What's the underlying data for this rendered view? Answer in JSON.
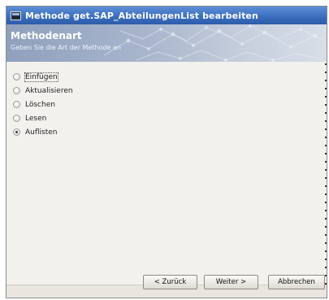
{
  "window": {
    "title": "Methode get.SAP_AbteilungenList bearbeiten"
  },
  "banner": {
    "title": "Methodenart",
    "subtitle": "Geben Sie die Art der Methode an"
  },
  "method_types": {
    "options": [
      {
        "label": "Einfügen",
        "selected": false,
        "focused": true
      },
      {
        "label": "Aktualisieren",
        "selected": false,
        "focused": false
      },
      {
        "label": "Löschen",
        "selected": false,
        "focused": false
      },
      {
        "label": "Lesen",
        "selected": false,
        "focused": false
      },
      {
        "label": "Auflisten",
        "selected": true,
        "focused": false
      }
    ]
  },
  "buttons": {
    "back": "< Zurück",
    "next": "Weiter >",
    "cancel": "Abbrechen"
  },
  "colors": {
    "titlebar": "#3c6fbf",
    "banner": "#a9b6cd",
    "background": "#ece9e3"
  }
}
